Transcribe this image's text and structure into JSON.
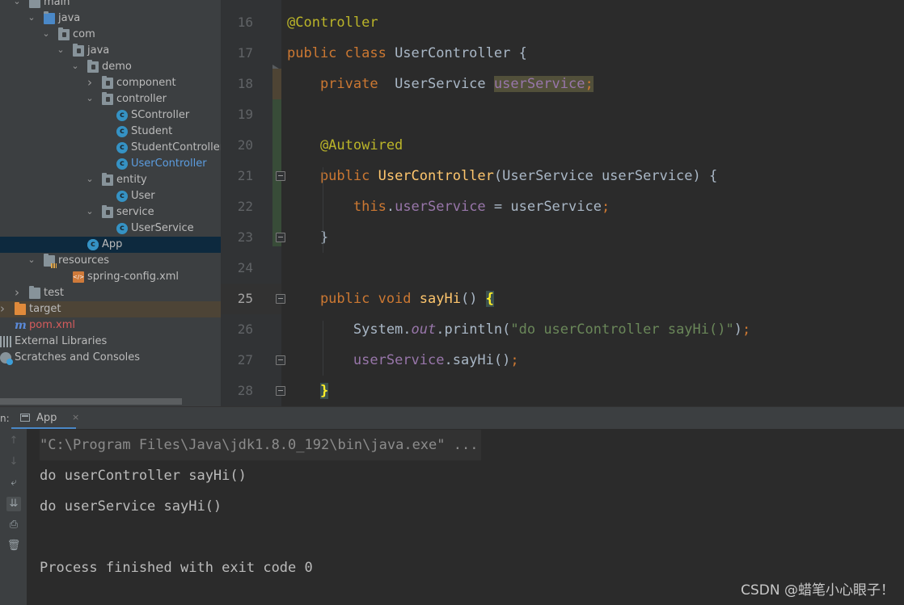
{
  "project_tree": [
    {
      "label": "main",
      "icon": "folder-icon",
      "indent": 0,
      "expanded": true
    },
    {
      "label": "java",
      "icon": "source-folder-icon",
      "indent": 1,
      "expanded": true
    },
    {
      "label": "com",
      "icon": "package-icon",
      "indent": 2,
      "expanded": true
    },
    {
      "label": "java",
      "icon": "package-icon",
      "indent": 3,
      "expanded": true
    },
    {
      "label": "demo",
      "icon": "package-icon",
      "indent": 4,
      "expanded": true
    },
    {
      "label": "component",
      "icon": "package-icon",
      "indent": 5,
      "expanded": false
    },
    {
      "label": "controller",
      "icon": "package-icon",
      "indent": 5,
      "expanded": true
    },
    {
      "label": "SController",
      "icon": "class-icon",
      "indent": 6
    },
    {
      "label": "Student",
      "icon": "class-icon",
      "indent": 6
    },
    {
      "label": "StudentController",
      "icon": "class-icon",
      "indent": 6
    },
    {
      "label": "UserController",
      "icon": "class-icon",
      "indent": 6,
      "active": true
    },
    {
      "label": "entity",
      "icon": "package-icon",
      "indent": 5,
      "expanded": true
    },
    {
      "label": "User",
      "icon": "class-icon",
      "indent": 6
    },
    {
      "label": "service",
      "icon": "package-icon",
      "indent": 5,
      "expanded": true
    },
    {
      "label": "UserService",
      "icon": "class-icon",
      "indent": 6
    },
    {
      "label": "App",
      "icon": "app-class-icon",
      "indent": 4,
      "selected": true
    },
    {
      "label": "resources",
      "icon": "resources-folder-icon",
      "indent": 1,
      "expanded": true
    },
    {
      "label": "spring-config.xml",
      "icon": "xml-file-icon",
      "indent": 3
    },
    {
      "label": "test",
      "icon": "folder-icon",
      "indent": 0,
      "expanded": false
    },
    {
      "label": "target",
      "icon": "excluded-folder-icon",
      "indent": -1,
      "expanded": false,
      "excluded": true
    },
    {
      "label": "pom.xml",
      "icon": "maven-icon",
      "indent": -1
    },
    {
      "label": "External Libraries",
      "icon": "libraries-icon",
      "indent": -2
    },
    {
      "label": "Scratches and Consoles",
      "icon": "scratches-icon",
      "indent": -2
    }
  ],
  "editor": {
    "current_line": "25",
    "lines": [
      {
        "num": "16",
        "tokens": [
          {
            "t": "@Controller",
            "c": "ann"
          }
        ]
      },
      {
        "num": "17",
        "tokens": [
          {
            "t": "public class ",
            "c": "kw"
          },
          {
            "t": "UserController {",
            "c": ""
          }
        ]
      },
      {
        "num": "18",
        "tokens": [
          {
            "t": "    private  ",
            "c": "kw"
          },
          {
            "t": "UserService ",
            "c": ""
          },
          {
            "t": "userService",
            "c": "fld hl-usage"
          },
          {
            "t": ";",
            "c": "semi hl-usage"
          }
        ]
      },
      {
        "num": "19",
        "tokens": []
      },
      {
        "num": "20",
        "tokens": [
          {
            "t": "    @Autowired",
            "c": "ann"
          }
        ]
      },
      {
        "num": "21",
        "tokens": [
          {
            "t": "    public ",
            "c": "kw"
          },
          {
            "t": "UserController",
            "c": "mth"
          },
          {
            "t": "(UserService userService) {",
            "c": ""
          }
        ]
      },
      {
        "num": "22",
        "tokens": [
          {
            "t": "        this",
            "c": "kw"
          },
          {
            "t": ".",
            "c": ""
          },
          {
            "t": "userService",
            "c": "fld"
          },
          {
            "t": " = userService",
            "c": ""
          },
          {
            "t": ";",
            "c": "semi"
          }
        ]
      },
      {
        "num": "23",
        "tokens": [
          {
            "t": "    }",
            "c": ""
          }
        ]
      },
      {
        "num": "24",
        "tokens": []
      },
      {
        "num": "25",
        "tokens": [
          {
            "t": "    public void ",
            "c": "kw"
          },
          {
            "t": "sayHi",
            "c": "mth"
          },
          {
            "t": "() ",
            "c": ""
          },
          {
            "t": "{",
            "c": "brace-match"
          }
        ]
      },
      {
        "num": "26",
        "tokens": [
          {
            "t": "        System.",
            "c": ""
          },
          {
            "t": "out",
            "c": "fld italic"
          },
          {
            "t": ".println(",
            "c": ""
          },
          {
            "t": "\"do userController sayHi()\"",
            "c": "str"
          },
          {
            "t": ")",
            "c": ""
          },
          {
            "t": ";",
            "c": "semi"
          }
        ]
      },
      {
        "num": "27",
        "tokens": [
          {
            "t": "        ",
            "c": ""
          },
          {
            "t": "userService",
            "c": "fld"
          },
          {
            "t": ".sayHi()",
            "c": ""
          },
          {
            "t": ";",
            "c": "semi"
          }
        ]
      },
      {
        "num": "28",
        "tokens": [
          {
            "t": "    ",
            "c": ""
          },
          {
            "t": "}",
            "c": "brace-match"
          }
        ]
      }
    ]
  },
  "run_window": {
    "label": "n:",
    "tab_label": "App",
    "tab_close": "×",
    "toolbar": [
      {
        "icon": "up-arrow-icon",
        "glyph": "↑",
        "dim": true
      },
      {
        "icon": "down-arrow-icon",
        "glyph": "↓",
        "dim": true
      },
      {
        "icon": "soft-wrap-icon",
        "glyph": "⤶"
      },
      {
        "icon": "scroll-to-end-icon",
        "glyph": "⇊",
        "active": true
      },
      {
        "icon": "print-icon",
        "glyph": "⎙"
      },
      {
        "icon": "trash-icon",
        "glyph": "🗑"
      }
    ],
    "console_lines": [
      {
        "text": "\"C:\\Program Files\\Java\\jdk1.8.0_192\\bin\\java.exe\" ...",
        "cmd": true
      },
      {
        "text": "do userController sayHi()"
      },
      {
        "text": "do userService sayHi()"
      },
      {
        "text": ""
      },
      {
        "text": "Process finished with exit code 0"
      }
    ]
  },
  "watermark": "CSDN @蜡笔小心眼子！"
}
